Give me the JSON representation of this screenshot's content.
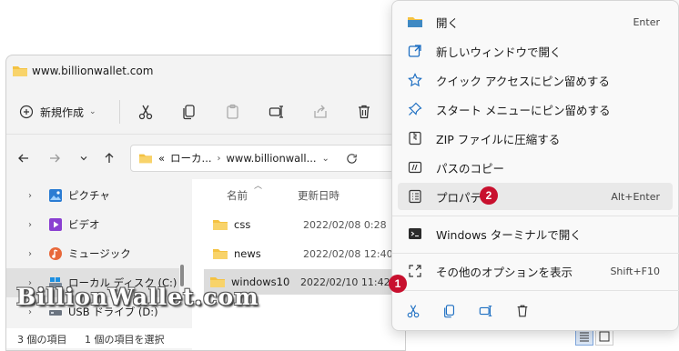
{
  "window": {
    "title": "www.billionwallet.com",
    "toolbar": {
      "new_label": "新規作成"
    },
    "address": {
      "parts": [
        "«",
        "ローカ...",
        "www.billionwall..."
      ]
    },
    "sidebar": {
      "items": [
        {
          "label": "ピクチャ",
          "icon": "pictures-icon"
        },
        {
          "label": "ビデオ",
          "icon": "video-icon"
        },
        {
          "label": "ミュージック",
          "icon": "music-icon"
        },
        {
          "label": "ローカル ディスク (C:)",
          "icon": "drive-icon",
          "selected": true
        },
        {
          "label": "USB ドライブ (D:)",
          "icon": "usb-drive-icon"
        }
      ]
    },
    "columns": {
      "name": "名前",
      "modified": "更新日時"
    },
    "files": [
      {
        "name": "css",
        "date": "2022/02/08 0:28"
      },
      {
        "name": "news",
        "date": "2022/02/08 12:40"
      },
      {
        "name": "windows10",
        "date": "2022/02/10 11:42",
        "selected": true
      }
    ],
    "status": {
      "count": "3 個の項目",
      "selected": "1 個の項目を選択"
    }
  },
  "menu": {
    "items": [
      {
        "label": "開く",
        "shortcut": "Enter",
        "icon": "folder-open-icon"
      },
      {
        "label": "新しいウィンドウで開く",
        "shortcut": "",
        "icon": "new-window-icon"
      },
      {
        "label": "クイック アクセスにピン留めする",
        "shortcut": "",
        "icon": "star-icon"
      },
      {
        "label": "スタート メニューにピン留めする",
        "shortcut": "",
        "icon": "pin-icon"
      },
      {
        "label": "ZIP ファイルに圧縮する",
        "shortcut": "",
        "icon": "zip-icon"
      },
      {
        "label": "パスのコピー",
        "shortcut": "",
        "icon": "copy-path-icon"
      },
      {
        "label": "プロパティ",
        "shortcut": "Alt+Enter",
        "icon": "properties-icon",
        "highlighted": true
      },
      {
        "label": "Windows ターミナルで開く",
        "shortcut": "",
        "icon": "terminal-icon"
      },
      {
        "label": "その他のオプションを表示",
        "shortcut": "Shift+F10",
        "icon": "more-options-icon"
      }
    ]
  },
  "badges": {
    "one": "1",
    "two": "2"
  },
  "watermark": "BillionWallet.com",
  "colors": {
    "accent": "#0067c0",
    "folder": "#f4c242",
    "badge": "#c8102e"
  }
}
